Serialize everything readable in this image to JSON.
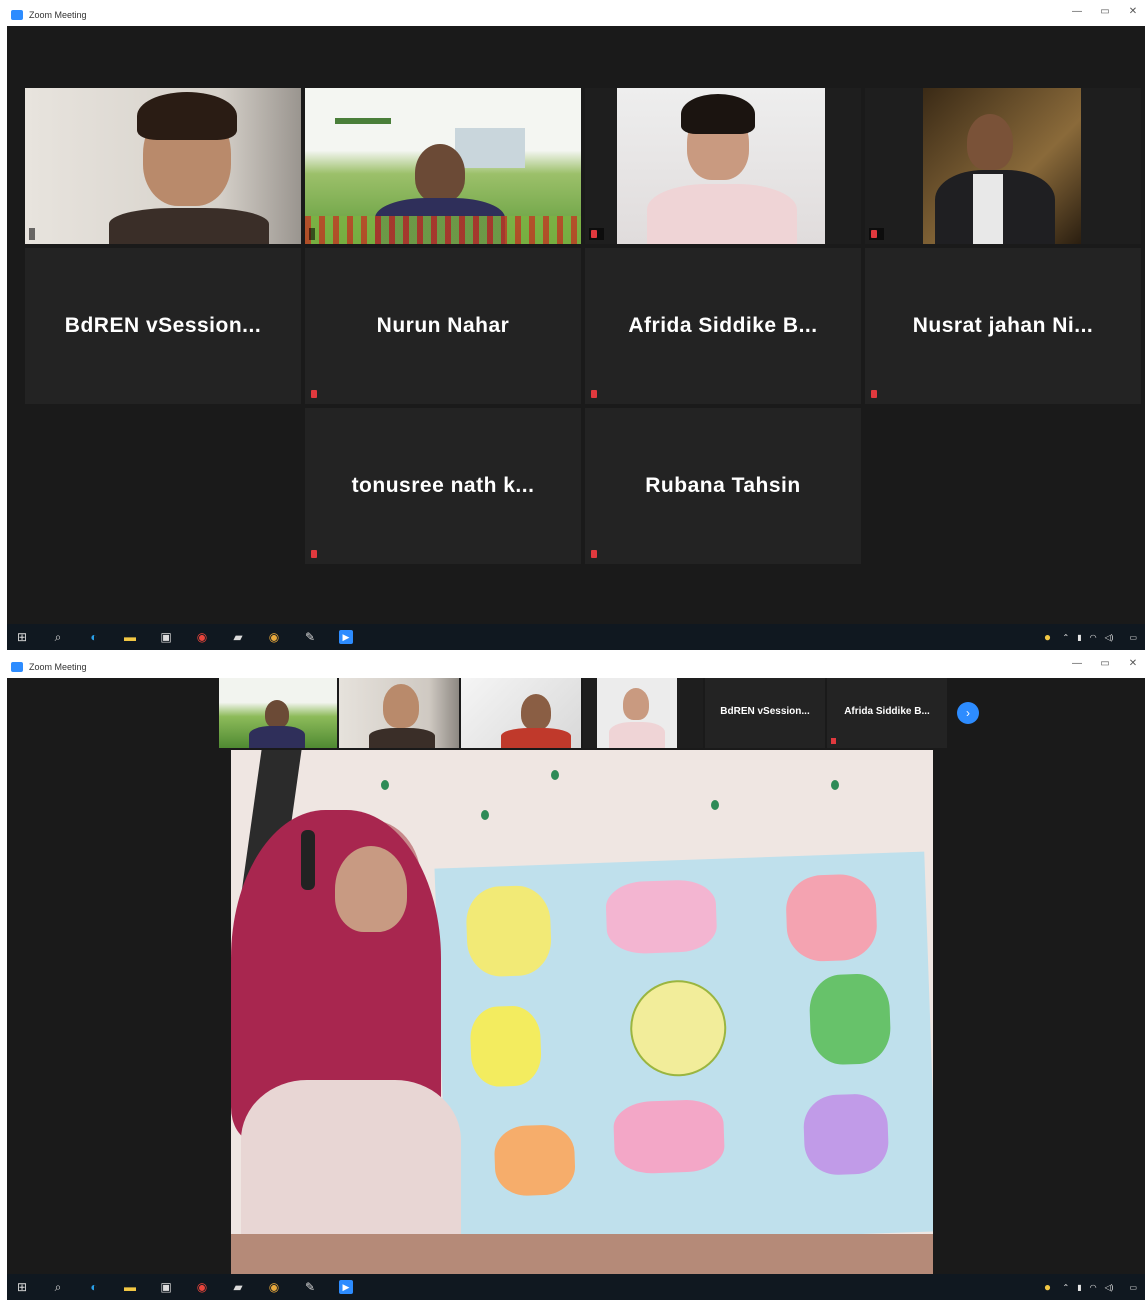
{
  "window": {
    "title": "Zoom Meeting",
    "controls": [
      "—",
      "▭",
      "✕"
    ]
  },
  "gallery": {
    "video_tiles": [
      {
        "name": ""
      },
      {
        "name": ""
      },
      {
        "name": ""
      },
      {
        "name": ""
      }
    ],
    "name_tiles": [
      {
        "display": "BdREN vSession...",
        "tag": ""
      },
      {
        "display": "Nurun Nahar",
        "tag": ""
      },
      {
        "display": "Afrida Siddike B...",
        "tag": ""
      },
      {
        "display": "Nusrat jahan Ni...",
        "tag": ""
      },
      {
        "display": "tonusree nath k...",
        "tag": ""
      },
      {
        "display": "Rubana Tahsin",
        "tag": ""
      }
    ]
  },
  "speaker_view": {
    "strip_names": [
      {
        "display": "BdREN vSession...",
        "tag": ""
      },
      {
        "display": "Afrida Siddike B...",
        "tag": ""
      }
    ],
    "nav_icon": "arrow-right-icon",
    "speaker_tag": ""
  },
  "taskbar": {
    "icons": [
      "windows-icon",
      "search-icon",
      "edge-icon",
      "file-explorer-icon",
      "store-icon",
      "chrome-icon",
      "photos-icon",
      "chrome-icon",
      "paint-icon",
      "zoom-icon"
    ],
    "clock_time": "",
    "clock_date": ""
  },
  "colors": {
    "zoom_blue": "#2d8cff",
    "active_speaker_border": "#c7d943",
    "mic_muted": "#e0393e",
    "background": "#1a1a1a"
  }
}
